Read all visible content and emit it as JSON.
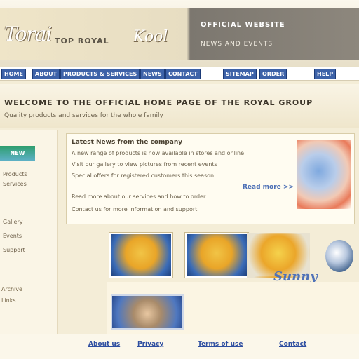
{
  "header": {
    "logo_text": "Torai",
    "tagline": "TOP ROYAL",
    "logo2_text": "Kool",
    "right_title": "OFFICIAL WEBSITE",
    "right_subtitle": "NEWS AND EVENTS"
  },
  "nav": {
    "items": [
      "HOME",
      "ABOUT",
      "PRODUCTS & SERVICES",
      "NEWS",
      "CONTACT",
      "SITEMAP",
      "ORDER",
      "HELP"
    ]
  },
  "banner": {
    "headline": "WELCOME TO THE OFFICIAL HOME PAGE OF THE ROYAL GROUP",
    "subline": "Quality products and services for the whole family"
  },
  "left_col": {
    "badge": "NEW",
    "links": [
      "Products",
      "Services",
      "Gallery",
      "Events",
      "Support"
    ],
    "small_links": [
      "Archive",
      "Links"
    ]
  },
  "content": {
    "title": "Latest News from the company",
    "lines": [
      "A new range of products is now available in stores and online",
      "Visit our gallery to view pictures from recent events",
      "Special offers for registered customers this season",
      "Read more about our services and how to order",
      "Contact us for more information and support"
    ],
    "link_text": "Read more >>"
  },
  "products": {
    "brand_script": "Sunny"
  },
  "footer": {
    "links": [
      "About us",
      "Privacy",
      "Terms of use",
      "Contact"
    ]
  }
}
